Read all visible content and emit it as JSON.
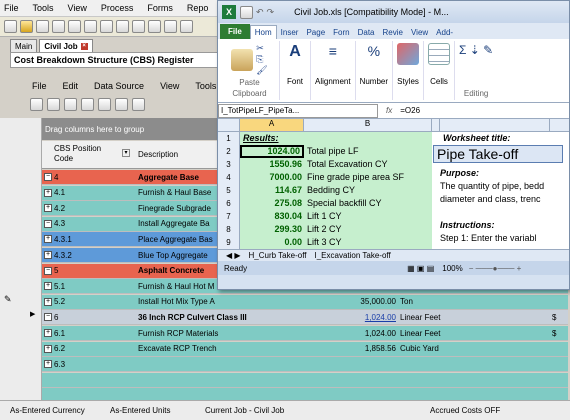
{
  "app_menu": [
    "File",
    "Tools",
    "View",
    "Process",
    "Forms",
    "Repo"
  ],
  "tabs": [
    {
      "label": "Main"
    },
    {
      "label": "Civil Job"
    }
  ],
  "register_title": "Cost Breakdown Structure (CBS) Register",
  "inner_menu": [
    "File",
    "Edit",
    "Data Source",
    "View",
    "Tools"
  ],
  "group_hint": "Drag columns here to group",
  "columns": {
    "cbs": "CBS Position Code",
    "desc": "Description"
  },
  "rows": [
    {
      "code": "4",
      "desc": "Aggregate Base",
      "qty": "",
      "unit": "",
      "tail": "",
      "style": "red",
      "exp": "−"
    },
    {
      "code": "4.1",
      "desc": "Furnish & Haul Base",
      "qty": "",
      "unit": "",
      "tail": "",
      "style": "teal",
      "exp": "+"
    },
    {
      "code": "4.2",
      "desc": "Finegrade Subgrade",
      "qty": "",
      "unit": "",
      "tail": "",
      "style": "teal",
      "exp": "+"
    },
    {
      "code": "4.3",
      "desc": "Install Aggregate Ba",
      "qty": "",
      "unit": "",
      "tail": "",
      "style": "teal",
      "exp": "−"
    },
    {
      "code": "4.3.1",
      "desc": "Place Aggregate Bas",
      "qty": "",
      "unit": "",
      "tail": "",
      "style": "blue",
      "exp": "+"
    },
    {
      "code": "4.3.2",
      "desc": "Blue Top Aggregate",
      "qty": "",
      "unit": "",
      "tail": "",
      "style": "blue",
      "exp": "+"
    },
    {
      "code": "5",
      "desc": "Asphalt Concrete",
      "qty": "",
      "unit": "",
      "tail": "",
      "style": "red",
      "exp": "−"
    },
    {
      "code": "5.1",
      "desc": "Furnish & Haul Hot M",
      "qty": "",
      "unit": "",
      "tail": "",
      "style": "teal",
      "exp": "+"
    },
    {
      "code": "5.2",
      "desc": "Install Hot Mix Type A",
      "qty": "35,000.00",
      "unit": "Ton",
      "tail": "",
      "style": "teal",
      "exp": "+"
    },
    {
      "code": "6",
      "desc": "36 Inch RCP Culvert Class III",
      "qty": "1,024.00",
      "unit": "Linear Feet",
      "tail": "$",
      "style": "gray",
      "exp": "−"
    },
    {
      "code": "6.1",
      "desc": "Furnish RCP Materials",
      "qty": "1,024.00",
      "unit": "Linear Feet",
      "tail": "$",
      "style": "teal",
      "exp": "+"
    },
    {
      "code": "6.2",
      "desc": "Excavate RCP Trench",
      "qty": "1,858.56",
      "unit": "Cubic Yard",
      "tail": "",
      "style": "teal",
      "exp": "+"
    },
    {
      "code": "6.3",
      "desc": "",
      "qty": "",
      "unit": "",
      "tail": "",
      "style": "teal",
      "exp": "+"
    },
    {
      "code": "",
      "desc": "",
      "qty": "",
      "unit": "",
      "tail": "",
      "style": "teal",
      "exp": ""
    },
    {
      "code": "",
      "desc": "",
      "qty": "",
      "unit": "",
      "tail": "",
      "style": "teal",
      "exp": ""
    },
    {
      "code": "",
      "desc": "",
      "qty": "",
      "unit": "",
      "tail": "",
      "style": "teal",
      "exp": ""
    }
  ],
  "status": [
    "As-Entered Currency",
    "As-Entered Units",
    "Current Job - Civil Job",
    "Accrued Costs OFF"
  ],
  "colors": {
    "red": "#e8644f",
    "teal": "#7fcbc4",
    "blue": "#5e9ad9",
    "gray": "#c8d0da"
  },
  "excel": {
    "title": "Civil Job.xls [Compatibility Mode] - M...",
    "ribbon_tabs": [
      "File",
      "Hom",
      "Inser",
      "Page",
      "Forn",
      "Data",
      "Revie",
      "View",
      "Add-"
    ],
    "groups": {
      "paste": "Paste",
      "clipboard": "Clipboard",
      "font": "Font",
      "alignment": "Alignment",
      "number": "Number",
      "styles": "Styles",
      "cells": "Cells",
      "editing": "Editing"
    },
    "name_box": "I_TotPipeLF_PipeTa...",
    "fx": "fx",
    "formula": "=O26",
    "col_a": "A",
    "col_b": "B",
    "results_label": "Results:",
    "rows": [
      {
        "n": "2",
        "a": "1024.00",
        "b": "Total pipe LF"
      },
      {
        "n": "3",
        "a": "1550.96",
        "b": "Total Excavation CY"
      },
      {
        "n": "4",
        "a": "7000.00",
        "b": "Fine grade pipe area SF"
      },
      {
        "n": "5",
        "a": "114.67",
        "b": "Bedding CY"
      },
      {
        "n": "6",
        "a": "275.08",
        "b": "Special backfill CY"
      },
      {
        "n": "7",
        "a": "830.04",
        "b": "Lift 1 CY"
      },
      {
        "n": "8",
        "a": "299.30",
        "b": "Lift 2 CY"
      },
      {
        "n": "9",
        "a": "0.00",
        "b": "Lift 3 CY"
      }
    ],
    "ws_title_label": "Worksheet title:",
    "ws_title": "Pipe Take-off",
    "purpose_label": "Purpose:",
    "purpose_1": "The quantity of pipe, bedd",
    "purpose_2": "diameter and class, trenc",
    "instr_label": "Instructions:",
    "instr_1": "Step 1: Enter the variabl",
    "sheet_tabs": [
      "H_Curb Take-off",
      "I_Excavation Take-off"
    ],
    "status": "Ready",
    "zoom": "100%"
  }
}
